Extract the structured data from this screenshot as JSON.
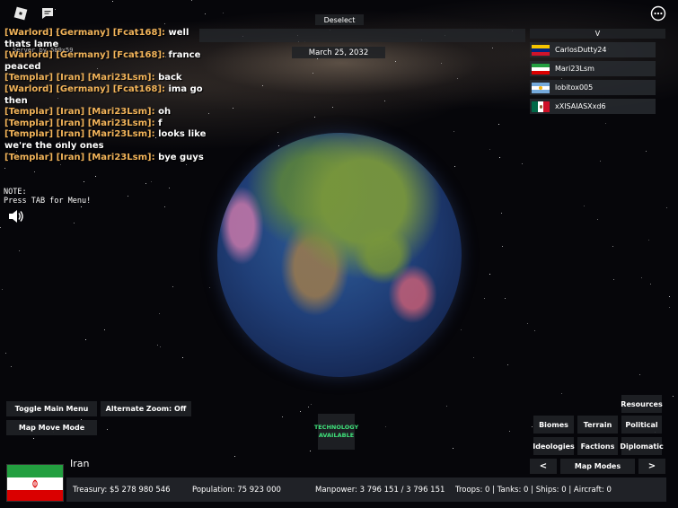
{
  "top": {
    "deselect_label": "Deselect",
    "date": "March 25, 2032",
    "player_list_header": "V",
    "overlapping_text": "Server by 589x59"
  },
  "chat": [
    {
      "prefix": "[Warlord] [Germany] [Fcat168]:",
      "message": "well thats lame"
    },
    {
      "prefix": "[Warlord] [Germany] [Fcat168]:",
      "message": "france peaced"
    },
    {
      "prefix": "[Templar] [Iran] [Mari23Lsm]:",
      "message": "back"
    },
    {
      "prefix": "[Warlord] [Germany] [Fcat168]:",
      "message": "ima go then"
    },
    {
      "prefix": "[Templar] [Iran] [Mari23Lsm]:",
      "message": "oh"
    },
    {
      "prefix": "[Templar] [Iran] [Mari23Lsm]:",
      "message": "f"
    },
    {
      "prefix": "[Templar] [Iran] [Mari23Lsm]:",
      "message": "looks like we're the only ones"
    },
    {
      "prefix": "[Templar] [Iran] [Mari23Lsm]:",
      "message": "bye guys"
    }
  ],
  "players": [
    {
      "name": "CarlosDutty24",
      "flag": "venezuela"
    },
    {
      "name": "Mari23Lsm",
      "flag": "iran"
    },
    {
      "name": "lobitox005",
      "flag": "argentina"
    },
    {
      "name": "xXISAIASXxd6",
      "flag": "mexico"
    }
  ],
  "note": {
    "line1": "NOTE:",
    "line2": "Press TAB for Menu!"
  },
  "left_buttons": {
    "toggle_main_menu": "Toggle Main Menu",
    "alternate_zoom": "Alternate Zoom: Off",
    "map_move_mode": "Map Move Mode"
  },
  "technology_notice": "TECHNOLOGY AVAILABLE",
  "map_buttons": {
    "resources": "Resources",
    "biomes": "Biomes",
    "terrain": "Terrain",
    "political": "Political",
    "ideologies": "Ideologies",
    "factions": "Factions",
    "diplomatic": "Diplomatic",
    "prev": "<",
    "map_modes": "Map Modes",
    "next": ">"
  },
  "country": {
    "name": "Iran",
    "treasury": "Treasury:  $5 278 980 546",
    "population": "Population: 75 923 000",
    "manpower": "Manpower: 3 796 151  /  3 796 151",
    "military": "Troops: 0  |  Tanks: 0  |  Ships: 0  |  Aircraft: 0"
  },
  "colors": {
    "chat_prefix": "#f2b45a",
    "tech_text": "#3fe07a",
    "panel_bg": "#23262a"
  }
}
